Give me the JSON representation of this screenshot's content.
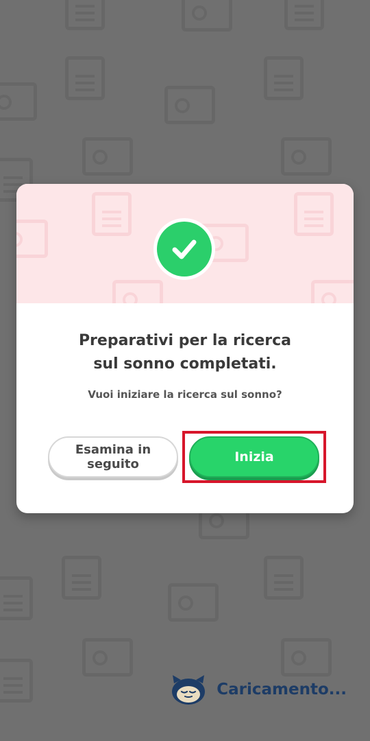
{
  "dialog": {
    "title_line1": "Preparativi per la ricerca",
    "title_line2": "sul sonno completati.",
    "message": "Vuoi iniziare la ricerca sul sonno?",
    "icon": "checkmark-icon",
    "later_button_label": "Esamina in seguito",
    "start_button_label": "Inizia"
  },
  "loading": {
    "text": "Caricamento...",
    "icon": "snorlax-icon"
  },
  "colors": {
    "accent_green": "#28d46a",
    "header_pink": "#fde6e8",
    "highlight_red": "#d7162b",
    "loading_text": "#1d3c66"
  }
}
